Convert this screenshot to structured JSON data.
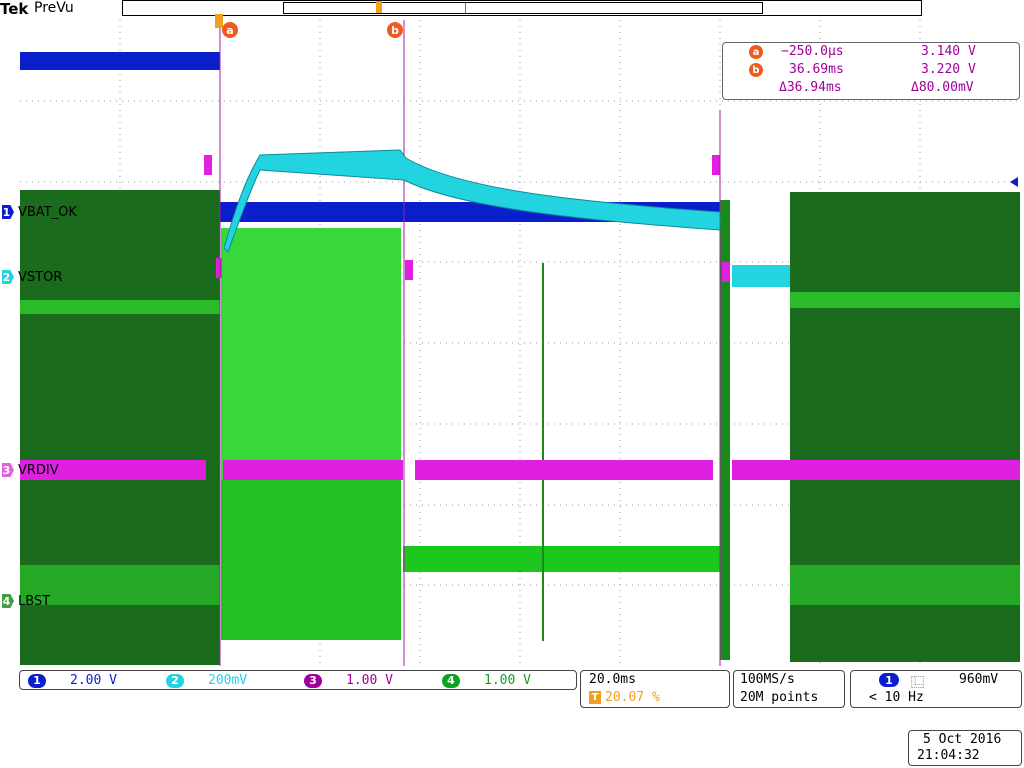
{
  "header": {
    "brand": "Tek",
    "mode": "PreVu"
  },
  "channels": [
    {
      "id": "1",
      "label": "VBAT_OK",
      "color": "#0a1ecc"
    },
    {
      "id": "2",
      "label": "VSTOR",
      "color": "#22d3e0"
    },
    {
      "id": "3",
      "label": "VRDIV",
      "color": "#e020e0"
    },
    {
      "id": "4",
      "label": "LBST",
      "color": "#10a020"
    }
  ],
  "cursors": {
    "a_mark": "a",
    "b_mark": "b",
    "a_time": "−250.0µs",
    "a_volt": "3.140 V",
    "b_time": "36.69ms",
    "b_volt": "3.220 V",
    "delta_time": "Δ36.94ms",
    "delta_volt": "Δ80.00mV"
  },
  "scales": [
    {
      "id": "1",
      "value": "2.00 V",
      "color": "#0a1ecc"
    },
    {
      "id": "2",
      "value": "200mV",
      "color": "#22d3e0"
    },
    {
      "id": "3",
      "value": "1.00 V",
      "color": "#a0009a"
    },
    {
      "id": "4",
      "value": "1.00 V",
      "color": "#10a020"
    }
  ],
  "timebase": {
    "per_div": "20.0ms",
    "trigger_pos": "20.07 %",
    "trigger_icon": "T"
  },
  "acquisition": {
    "sample_rate": "100MS/s",
    "record_length": "20M points"
  },
  "trigger": {
    "source": "1",
    "slope_icon": "⿺",
    "level": "960mV",
    "frequency": "< 10 Hz"
  },
  "datetime": {
    "date": "5 Oct  2016",
    "time": "21:04:32"
  }
}
